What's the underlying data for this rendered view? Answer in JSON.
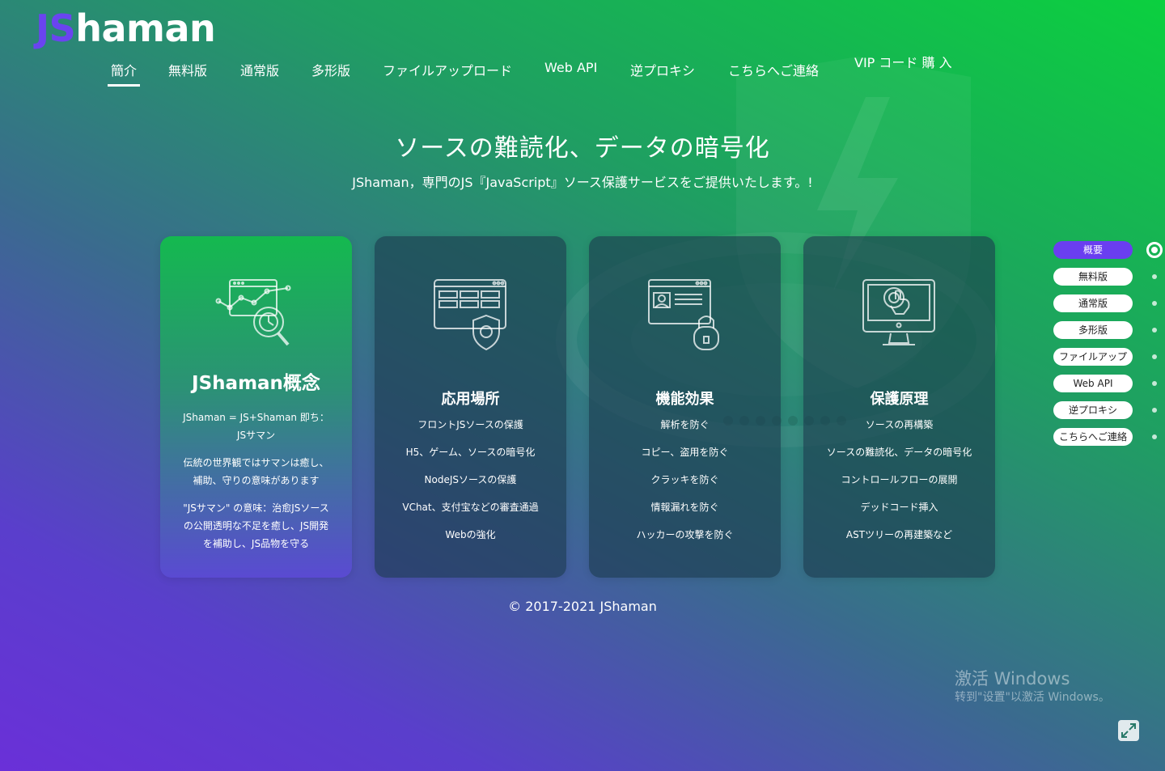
{
  "logo": {
    "js": "JS",
    "rest": "haman"
  },
  "nav": {
    "items": [
      "簡介",
      "無料版",
      "通常版",
      "多形版",
      "ファイルアップロード",
      "Web API",
      "逆プロキシ",
      "こちらへご連絡"
    ],
    "vip": "VIP コード 購 入",
    "active_index": 0
  },
  "hero": {
    "title": "ソースの難読化、データの暗号化",
    "subtitle": "JShaman，専門のJS『JavaScript』ソース保護サービスをご提供いたします。!"
  },
  "cards": [
    {
      "title": "JShaman概念",
      "icon": "chart-magnifier-icon",
      "paragraphs": [
        "JShaman = JS+Shaman 即ち：JSサマン",
        "伝統の世界観ではサマンは癒し、補助、守りの意味があります",
        "\"JSサマン\" の意味：治愈JSソースの公開透明な不足を癒し、JS開発を補助し、JS品物を守る"
      ]
    },
    {
      "title": "応用場所",
      "icon": "browser-shield-icon",
      "lines": [
        "フロントJSソースの保護",
        "H5、ゲーム、ソースの暗号化",
        "NodeJSソースの保護",
        "VChat、支付宝などの審査通過",
        "Webの強化"
      ]
    },
    {
      "title": "機能効果",
      "icon": "profile-lock-icon",
      "lines": [
        "解析を防ぐ",
        "コピー、盗用を防ぐ",
        "クラッキを防ぐ",
        "情報漏れを防ぐ",
        "ハッカーの攻撃を防ぐ"
      ]
    },
    {
      "title": "保護原理",
      "icon": "monitor-touch-icon",
      "lines": [
        "ソースの再構築",
        "ソースの難読化、データの暗号化",
        "コントロールフローの展開",
        "デッドコード挿入",
        "ASTツリーの再建築など"
      ]
    }
  ],
  "copyright": "© 2017-2021 JShaman",
  "side_nav": {
    "items": [
      "概要",
      "無料版",
      "通常版",
      "多形版",
      "ファイルアップ",
      "Web API",
      "逆プロキシ",
      "こちらへご連絡"
    ],
    "active_index": 0
  },
  "watermark": {
    "title": "激活 Windows",
    "subtitle": "转到\"设置\"以激活 Windows。"
  },
  "colors": {
    "accent": "#6a3ef0",
    "green": "#0bd03f",
    "purple": "#6a30d8"
  }
}
